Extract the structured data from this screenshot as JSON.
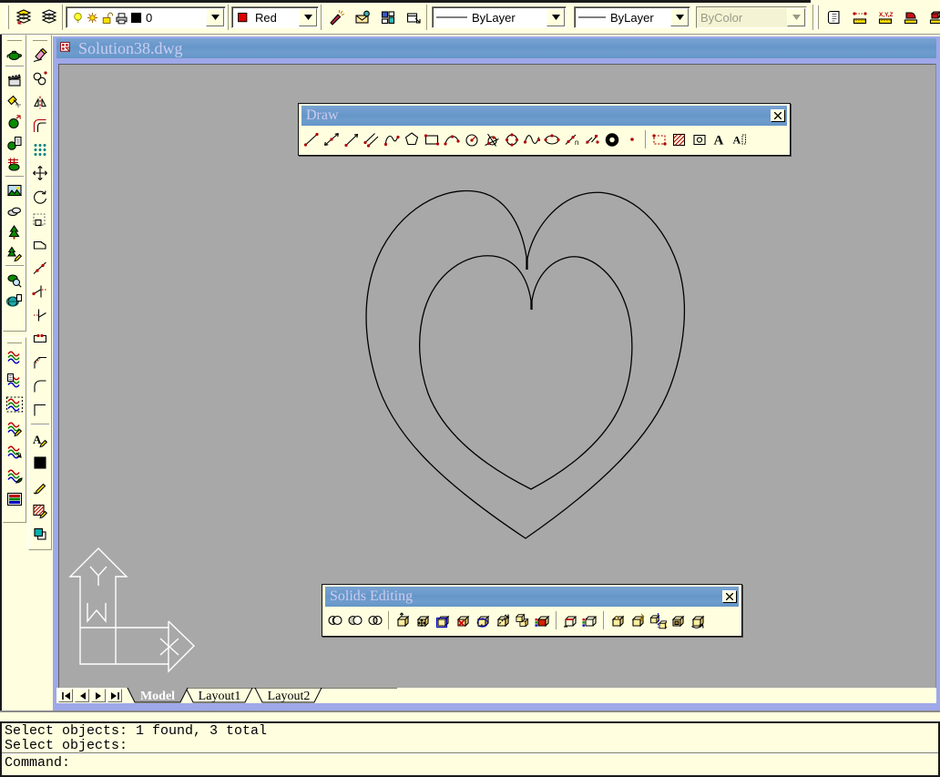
{
  "window": {
    "title": "Solution38.dwg"
  },
  "top_toolbar": {
    "left_icons": [
      "layers-current",
      "layers"
    ],
    "layer_combo": {
      "value": "0",
      "icons": [
        "bulb",
        "sun",
        "lock",
        "printer",
        "swatch-black"
      ]
    },
    "color_combo": {
      "value": "Red",
      "icon": "swatch-red"
    },
    "mid_icons": [
      "match-properties",
      "envelope",
      "designcenter",
      "properties-window"
    ],
    "linetype_combo": {
      "value": "ByLayer"
    },
    "lineweight_combo": {
      "value": "ByLayer"
    },
    "plotstyle_combo": {
      "value": "ByColor",
      "disabled": true
    },
    "right_icons": [
      "list",
      "distance",
      "locate-point",
      "area",
      "mass-properties"
    ]
  },
  "sidebar": {
    "render_toolbar": [
      "hide",
      "|",
      "render",
      "lights",
      "materials",
      "materials-library",
      "mapping",
      "|",
      "background",
      "fog",
      "landscape-new",
      "landscape-edit",
      "|",
      "render-preferences",
      "statistics"
    ],
    "rgb_toolbar": [
      "rgb-curves",
      "rgb-curves-doc",
      "rgb-curves-select",
      "rgb-curves-edit",
      "rgb-curves-arrow",
      "rgb-curves-shade",
      "rgb-curves-image"
    ],
    "modify_toolbar": [
      "erase",
      "copy",
      "mirror",
      "offset",
      "array",
      "move",
      "rotate",
      "scale",
      "stretch",
      "lengthen",
      "trim",
      "extend",
      "break",
      "chamfer",
      "fillet",
      "corner",
      "|",
      "edit-text",
      "color-swatch",
      "sketch",
      "edit-hatch",
      "draworder"
    ]
  },
  "draw_toolbar": {
    "title": "Draw",
    "icons": [
      "line",
      "construction-line",
      "ray",
      "multiline",
      "polyline",
      "polygon",
      "rectangle",
      "arc",
      "circle",
      "circle-ttr",
      "circle-quadrant",
      "spline",
      "ellipse",
      "divide",
      "measure",
      "donut",
      "point",
      "|",
      "boundary",
      "hatch",
      "region",
      "multiline-text",
      "single-line-text"
    ]
  },
  "solids_toolbar": {
    "title": "Solids Editing",
    "icons": [
      "union",
      "subtract",
      "intersect",
      "|",
      "extrude-faces",
      "move-faces",
      "offset-faces",
      "delete-faces",
      "rotate-faces",
      "taper-faces",
      "copy-faces",
      "color-faces",
      "|",
      "copy-edges",
      "color-edges",
      "|",
      "imprint",
      "clean",
      "separate",
      "shell",
      "check"
    ]
  },
  "tabs": {
    "nav": [
      "first",
      "prev",
      "next",
      "last"
    ],
    "items": [
      {
        "label": "Model",
        "active": true
      },
      {
        "label": "Layout1",
        "active": false
      },
      {
        "label": "Layout2",
        "active": false
      }
    ]
  },
  "command": {
    "history": [
      "Select objects: 1 found, 3 total",
      "Select objects:"
    ],
    "prompt": "Command:"
  }
}
